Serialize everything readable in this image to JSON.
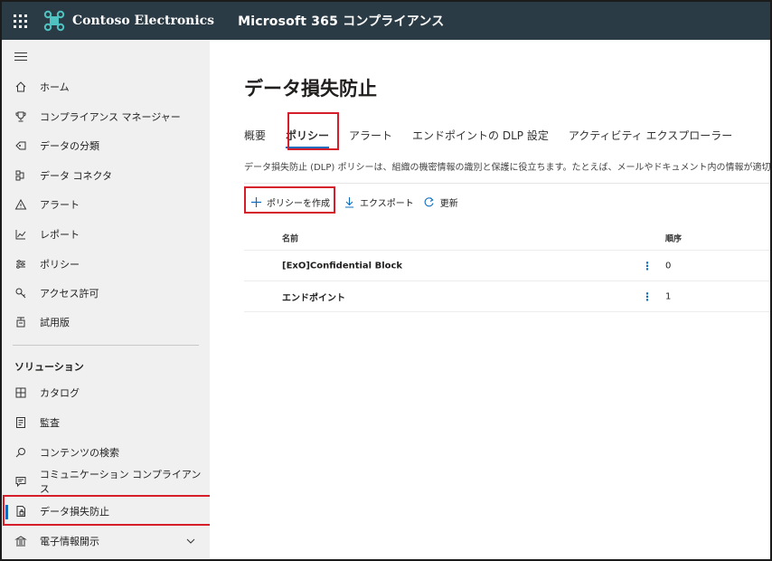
{
  "topbar": {
    "brand_name": "Contoso Electronics",
    "suite_title": "Microsoft 365 コンプライアンス",
    "bg_color": "#2b3b46",
    "logo_color": "#4fc3c1"
  },
  "sidebar": {
    "items": [
      {
        "label": "ホーム",
        "icon": "home-icon"
      },
      {
        "label": "コンプライアンス マネージャー",
        "icon": "trophy-icon"
      },
      {
        "label": "データの分類",
        "icon": "tag-icon"
      },
      {
        "label": "データ コネクタ",
        "icon": "connector-icon"
      },
      {
        "label": "アラート",
        "icon": "warning-icon"
      },
      {
        "label": "レポート",
        "icon": "chart-icon"
      },
      {
        "label": "ポリシー",
        "icon": "sliders-icon"
      },
      {
        "label": "アクセス許可",
        "icon": "key-icon"
      },
      {
        "label": "試用版",
        "icon": "trial-icon"
      }
    ],
    "section_title": "ソリューション",
    "solutions": [
      {
        "label": "カタログ",
        "icon": "catalog-icon"
      },
      {
        "label": "監査",
        "icon": "audit-icon"
      },
      {
        "label": "コンテンツの検索",
        "icon": "search-icon"
      },
      {
        "label": "コミュニケーション コンプライアンス",
        "icon": "chat-icon"
      },
      {
        "label": "データ損失防止",
        "icon": "dlp-icon",
        "active": true
      },
      {
        "label": "電子情報開示",
        "icon": "ediscovery-icon"
      }
    ]
  },
  "main": {
    "title": "データ損失防止",
    "tabs": [
      {
        "label": "概要"
      },
      {
        "label": "ポリシー",
        "selected": true
      },
      {
        "label": "アラート"
      },
      {
        "label": "エンドポイントの DLP 設定"
      },
      {
        "label": "アクティビティ エクスプローラー"
      }
    ],
    "description": "データ損失防止 (DLP) ポリシーは、組織の機密情報の識別と保護に役立ちます。たとえば、メールやドキュメント内の情報が適切で",
    "commands": {
      "create": "ポリシーを作成",
      "export": "エクスポート",
      "refresh": "更新"
    },
    "table": {
      "headers": {
        "name": "名前",
        "order": "順序"
      },
      "rows": [
        {
          "name": "[ExO]Confidential Block",
          "order": "0"
        },
        {
          "name": "エンドポイント",
          "order": "1"
        }
      ]
    }
  },
  "accent_color": "#0f6cbd",
  "highlight_color": "#d61e2a"
}
